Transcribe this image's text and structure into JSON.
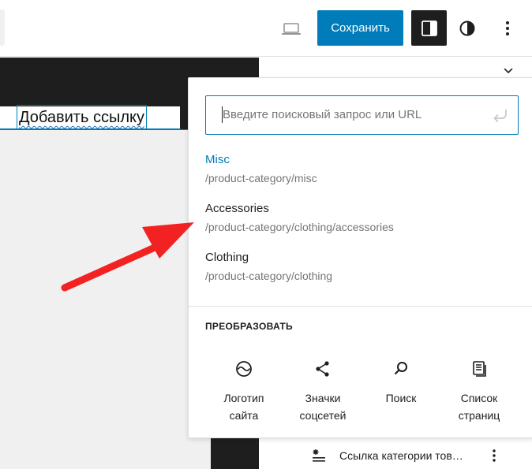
{
  "toolbar": {
    "save_label": "Сохранить",
    "icons": {
      "device_preview": "desktop-icon",
      "settings": "sidebar-panel-icon",
      "styles": "half-circle-contrast-icon",
      "more": "vertical-ellipsis-icon"
    },
    "accent_color": "#007cba"
  },
  "editor": {
    "link_text": "Добавить ссылку"
  },
  "link_popover": {
    "search_placeholder": "Введите поисковый запрос или URL",
    "search_value": "",
    "submit_icon": "enter-return-icon",
    "results": [
      {
        "title": "Misc",
        "url": "/product-category/misc",
        "active": true
      },
      {
        "title": "Accessories",
        "url": "/product-category/clothing/accessories",
        "active": false
      },
      {
        "title": "Clothing",
        "url": "/product-category/clothing",
        "active": false
      }
    ],
    "transform": {
      "heading": "ПРЕОБРАЗОВАТЬ",
      "items": [
        {
          "label_line1": "Логотип",
          "label_line2": "сайта",
          "icon": "site-logo-icon"
        },
        {
          "label_line1": "Значки",
          "label_line2": "соцсетей",
          "icon": "share-icon"
        },
        {
          "label_line1": "Поиск",
          "label_line2": "",
          "icon": "search-icon"
        },
        {
          "label_line1": "Список",
          "label_line2": "страниц",
          "icon": "page-list-icon"
        }
      ]
    }
  },
  "sidebar": {
    "list_item_label": "Ссылка категории тов…",
    "list_item_icon": "category-link-icon"
  },
  "annotation": {
    "arrow_color": "#f22222"
  }
}
